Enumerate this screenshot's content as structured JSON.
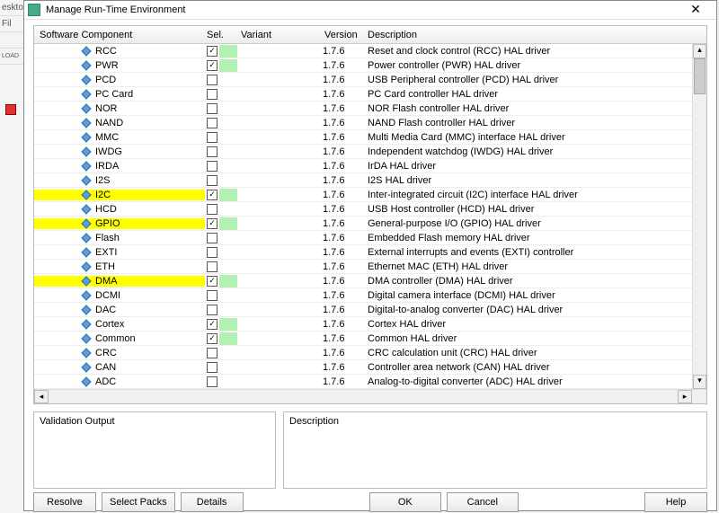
{
  "window": {
    "title": "Manage Run-Time Environment"
  },
  "columns": {
    "component": "Software Component",
    "sel": "Sel.",
    "variant": "Variant",
    "version": "Version",
    "description": "Description"
  },
  "rows": [
    {
      "name": "RCC",
      "checked": true,
      "green": true,
      "version": "1.7.6",
      "desc": "Reset and clock control (RCC) HAL driver",
      "hl": false
    },
    {
      "name": "PWR",
      "checked": true,
      "green": true,
      "version": "1.7.6",
      "desc": "Power controller (PWR) HAL driver",
      "hl": false
    },
    {
      "name": "PCD",
      "checked": false,
      "green": false,
      "version": "1.7.6",
      "desc": "USB Peripheral controller (PCD) HAL driver",
      "hl": false
    },
    {
      "name": "PC Card",
      "checked": false,
      "green": false,
      "version": "1.7.6",
      "desc": "PC Card controller HAL driver",
      "hl": false
    },
    {
      "name": "NOR",
      "checked": false,
      "green": false,
      "version": "1.7.6",
      "desc": "NOR Flash controller HAL driver",
      "hl": false
    },
    {
      "name": "NAND",
      "checked": false,
      "green": false,
      "version": "1.7.6",
      "desc": "NAND Flash controller HAL driver",
      "hl": false
    },
    {
      "name": "MMC",
      "checked": false,
      "green": false,
      "version": "1.7.6",
      "desc": "Multi Media Card (MMC) interface HAL driver",
      "hl": false
    },
    {
      "name": "IWDG",
      "checked": false,
      "green": false,
      "version": "1.7.6",
      "desc": "Independent watchdog (IWDG) HAL driver",
      "hl": false
    },
    {
      "name": "IRDA",
      "checked": false,
      "green": false,
      "version": "1.7.6",
      "desc": "IrDA HAL driver",
      "hl": false
    },
    {
      "name": "I2S",
      "checked": false,
      "green": false,
      "version": "1.7.6",
      "desc": "I2S HAL driver",
      "hl": false
    },
    {
      "name": "I2C",
      "checked": true,
      "green": true,
      "version": "1.7.6",
      "desc": "Inter-integrated circuit (I2C) interface HAL driver",
      "hl": true
    },
    {
      "name": "HCD",
      "checked": false,
      "green": false,
      "version": "1.7.6",
      "desc": "USB Host controller (HCD) HAL driver",
      "hl": false
    },
    {
      "name": "GPIO",
      "checked": true,
      "green": true,
      "version": "1.7.6",
      "desc": "General-purpose I/O (GPIO) HAL driver",
      "hl": true
    },
    {
      "name": "Flash",
      "checked": false,
      "green": false,
      "version": "1.7.6",
      "desc": "Embedded Flash memory HAL driver",
      "hl": false
    },
    {
      "name": "EXTI",
      "checked": false,
      "green": false,
      "version": "1.7.6",
      "desc": "External interrupts and events (EXTI) controller",
      "hl": false
    },
    {
      "name": "ETH",
      "checked": false,
      "green": false,
      "version": "1.7.6",
      "desc": "Ethernet MAC (ETH) HAL driver",
      "hl": false
    },
    {
      "name": "DMA",
      "checked": true,
      "green": true,
      "version": "1.7.6",
      "desc": "DMA controller (DMA) HAL driver",
      "hl": true
    },
    {
      "name": "DCMI",
      "checked": false,
      "green": false,
      "version": "1.7.6",
      "desc": "Digital camera interface (DCMI) HAL driver",
      "hl": false
    },
    {
      "name": "DAC",
      "checked": false,
      "green": false,
      "version": "1.7.6",
      "desc": "Digital-to-analog converter (DAC) HAL driver",
      "hl": false
    },
    {
      "name": "Cortex",
      "checked": true,
      "green": true,
      "version": "1.7.6",
      "desc": "Cortex HAL driver",
      "hl": false
    },
    {
      "name": "Common",
      "checked": true,
      "green": true,
      "version": "1.7.6",
      "desc": "Common HAL driver",
      "hl": false
    },
    {
      "name": "CRC",
      "checked": false,
      "green": false,
      "version": "1.7.6",
      "desc": "CRC calculation unit (CRC) HAL driver",
      "hl": false
    },
    {
      "name": "CAN",
      "checked": false,
      "green": false,
      "version": "1.7.6",
      "desc": "Controller area network (CAN) HAL driver",
      "hl": false
    },
    {
      "name": "ADC",
      "checked": false,
      "green": false,
      "version": "1.7.6",
      "desc": "Analog-to-digital converter (ADC) HAL driver",
      "hl": false
    }
  ],
  "panels": {
    "validation": "Validation Output",
    "description": "Description"
  },
  "buttons": {
    "resolve": "Resolve",
    "select_packs": "Select Packs",
    "details": "Details",
    "ok": "OK",
    "cancel": "Cancel",
    "help": "Help"
  },
  "bg": {
    "desktop": "eskto",
    "file": "Fil",
    "load": "LOAD"
  }
}
